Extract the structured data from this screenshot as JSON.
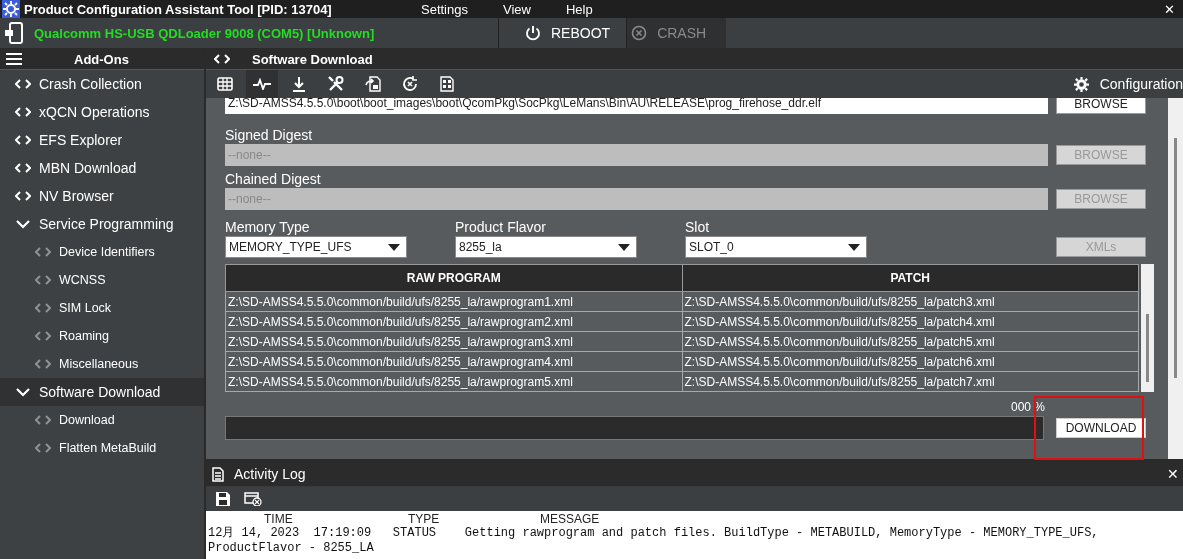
{
  "title_bar": {
    "title": "Product Configuration Assistant Tool [PID: 13704]",
    "menu": [
      "Settings",
      "View",
      "Help"
    ],
    "close": "✕"
  },
  "device_bar": {
    "device": "Qualcomm HS-USB QDLoader 9008 (COM5) [Unknown]",
    "buttons": [
      {
        "label": "REBOOT",
        "kind": "power",
        "disabled": false
      },
      {
        "label": "CRASH",
        "kind": "crash",
        "disabled": true
      }
    ]
  },
  "sidebar": {
    "title": "Add-Ons",
    "items": [
      {
        "label": "Crash Collection",
        "selected": false
      },
      {
        "label": "xQCN Operations",
        "selected": false
      },
      {
        "label": "EFS Explorer",
        "selected": false
      },
      {
        "label": "MBN Download",
        "selected": false
      },
      {
        "label": "NV Browser",
        "selected": false
      },
      {
        "label": "Service Programming",
        "selected": false,
        "expanded": true,
        "children": [
          {
            "label": "Device Identifiers",
            "selected": false
          },
          {
            "label": "WCNSS",
            "selected": false
          },
          {
            "label": "SIM Lock",
            "selected": false
          },
          {
            "label": "Roaming",
            "selected": false
          },
          {
            "label": "Miscellaneous",
            "selected": false
          }
        ]
      },
      {
        "label": "Software Download",
        "selected": true,
        "expanded": true,
        "children": [
          {
            "label": "Download",
            "selected": false
          },
          {
            "label": "Flatten MetaBuild",
            "selected": false
          }
        ]
      }
    ]
  },
  "panel": {
    "title": "Software Download",
    "toolbar": [
      {
        "kind": "table",
        "selected": false
      },
      {
        "kind": "pulse",
        "selected": true
      },
      {
        "kind": "download",
        "selected": false
      },
      {
        "kind": "tools",
        "selected": false
      },
      {
        "kind": "export",
        "selected": false
      },
      {
        "kind": "restore",
        "selected": false
      },
      {
        "kind": "text-file",
        "selected": false
      }
    ],
    "configuration": "Configuration"
  },
  "form": {
    "programmer": {
      "value": "Z:\\SD-AMSS4.5.5.0\\boot\\boot_images\\boot\\QcomPkg\\SocPkg\\LeMans\\Bin\\AU\\RELEASE\\prog_firehose_ddr.elf",
      "button": {
        "label": "BROWSE",
        "disabled": false
      }
    },
    "digests": [
      {
        "label": "Signed Digest",
        "placeholder": "--none--",
        "button": {
          "label": "BROWSE",
          "disabled": true
        }
      },
      {
        "label": "Chained Digest",
        "placeholder": "--none--",
        "button": {
          "label": "BROWSE",
          "disabled": true
        }
      }
    ],
    "dropdowns": [
      {
        "label": "Memory Type",
        "value": "MEMORY_TYPE_UFS"
      },
      {
        "label": "Product Flavor",
        "value": "8255_la"
      },
      {
        "label": "Slot",
        "value": "SLOT_0"
      }
    ],
    "xmls_button": {
      "label": "XMLs",
      "disabled": true
    }
  },
  "table": {
    "columns": [
      "RAW PROGRAM",
      "PATCH"
    ],
    "rows": [
      [
        "Z:\\SD-AMSS4.5.5.0\\common/build/ufs/8255_la/rawprogram1.xml",
        "Z:\\SD-AMSS4.5.5.0\\common/build/ufs/8255_la/patch3.xml"
      ],
      [
        "Z:\\SD-AMSS4.5.5.0\\common/build/ufs/8255_la/rawprogram2.xml",
        "Z:\\SD-AMSS4.5.5.0\\common/build/ufs/8255_la/patch4.xml"
      ],
      [
        "Z:\\SD-AMSS4.5.5.0\\common/build/ufs/8255_la/rawprogram3.xml",
        "Z:\\SD-AMSS4.5.5.0\\common/build/ufs/8255_la/patch5.xml"
      ],
      [
        "Z:\\SD-AMSS4.5.5.0\\common/build/ufs/8255_la/rawprogram4.xml",
        "Z:\\SD-AMSS4.5.5.0\\common/build/ufs/8255_la/patch6.xml"
      ],
      [
        "Z:\\SD-AMSS4.5.5.0\\common/build/ufs/8255_la/rawprogram5.xml",
        "Z:\\SD-AMSS4.5.5.0\\common/build/ufs/8255_la/patch7.xml"
      ]
    ]
  },
  "progress": {
    "reading": "000 %",
    "level": 0
  },
  "download_button": {
    "label": "DOWNLOAD",
    "highlighted": true
  },
  "activity_log": {
    "title": "Activity Log",
    "close": "✕",
    "columns": [
      "TIME",
      "TYPE",
      "MESSAGE"
    ],
    "lines": [
      "12月 14, 2023  17:19:09   STATUS    Getting rawprogram and patch files. BuildType - METABUILD, MemoryType - MEMORY_TYPE_UFS,",
      "ProductFlavor - 8255_LA"
    ]
  }
}
